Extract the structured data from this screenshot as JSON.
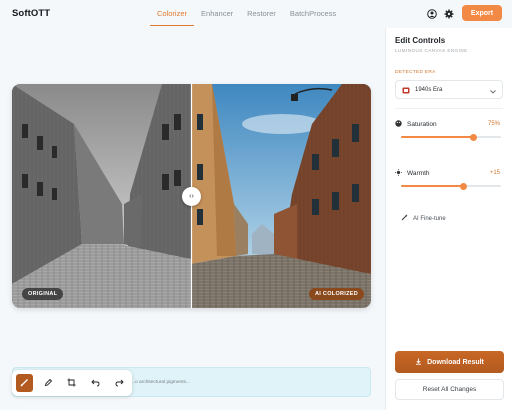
{
  "app": {
    "title": "SoftOTT"
  },
  "nav": {
    "tabs": [
      {
        "label": "Colorizer",
        "active": true
      },
      {
        "label": "Enhancer",
        "active": false
      },
      {
        "label": "Restorer",
        "active": false
      },
      {
        "label": "BatchProcess",
        "active": false
      }
    ]
  },
  "header": {
    "export_label": "Export",
    "icons": [
      "user-icon",
      "gear-icon"
    ]
  },
  "stage": {
    "left_badge": "ORIGINAL",
    "right_badge": "AI COLORIZED",
    "split_handle_glyph": "‹›"
  },
  "panel": {
    "title": "Edit Controls",
    "subtitle": "LUMINOUS CANVAS ENGINE",
    "era_label": "DETECTED ERA",
    "era_value": "1940s Era",
    "saturation": {
      "label": "Saturation",
      "value_text": "75%",
      "level": 0.72
    },
    "warmth": {
      "label": "Warmth",
      "value_text": "+15",
      "level": 0.62
    },
    "finetune_label": "AI Fine-tune",
    "download_label": "Download Result",
    "reset_label": "Reset All Changes"
  },
  "prompt": {
    "text": "...o architectural pigments..."
  },
  "toolbar": {
    "tools": [
      "brush-icon",
      "pen-icon",
      "crop-icon",
      "undo-icon",
      "redo-icon"
    ]
  },
  "colors": {
    "accent": "#f28a45",
    "accent_dark": "#b25a1f"
  }
}
